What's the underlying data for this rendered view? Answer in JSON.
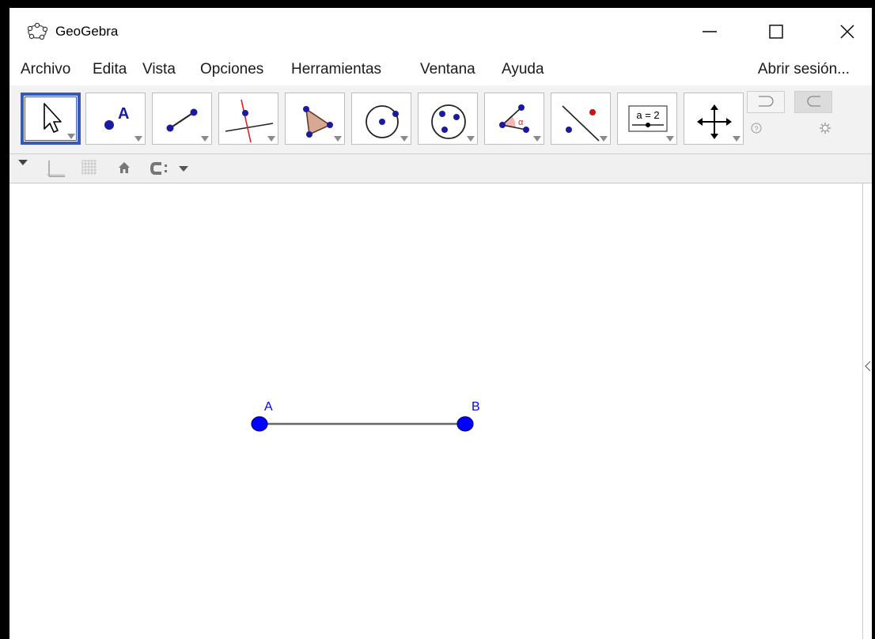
{
  "window": {
    "title": "GeoGebra",
    "controls": [
      "minimize-icon",
      "maximize-icon",
      "close-icon"
    ]
  },
  "menu": {
    "items": [
      "Archivo",
      "Edita",
      "Vista",
      "Opciones",
      "Herramientas",
      "Ventana",
      "Ayuda"
    ],
    "login": "Abrir sesión..."
  },
  "toolbar": {
    "tools": [
      {
        "icon": "move-arrow-icon",
        "selected": true
      },
      {
        "icon": "point-icon",
        "glyph": "A"
      },
      {
        "icon": "segment-icon"
      },
      {
        "icon": "perpendicular-line-icon"
      },
      {
        "icon": "polygon-icon"
      },
      {
        "icon": "circle-center-point-icon"
      },
      {
        "icon": "circle-three-points-icon"
      },
      {
        "icon": "angle-icon",
        "glyph": "α"
      },
      {
        "icon": "reflect-about-line-icon"
      },
      {
        "icon": "slider-icon",
        "glyph": "a = 2"
      },
      {
        "icon": "move-graphics-view-icon"
      }
    ],
    "side": [
      "undo-icon",
      "redo-icon",
      "help-icon",
      "settings-icon"
    ]
  },
  "stylebar": {
    "icons": [
      "collapse-triangle-icon",
      "axes-icon",
      "grid-icon",
      "home-icon",
      "point-capturing-icon"
    ]
  },
  "graphics": {
    "points": [
      {
        "name": "A",
        "color": "#0000ff"
      },
      {
        "name": "B",
        "color": "#0000ff"
      }
    ],
    "segment_color": "#666666"
  }
}
